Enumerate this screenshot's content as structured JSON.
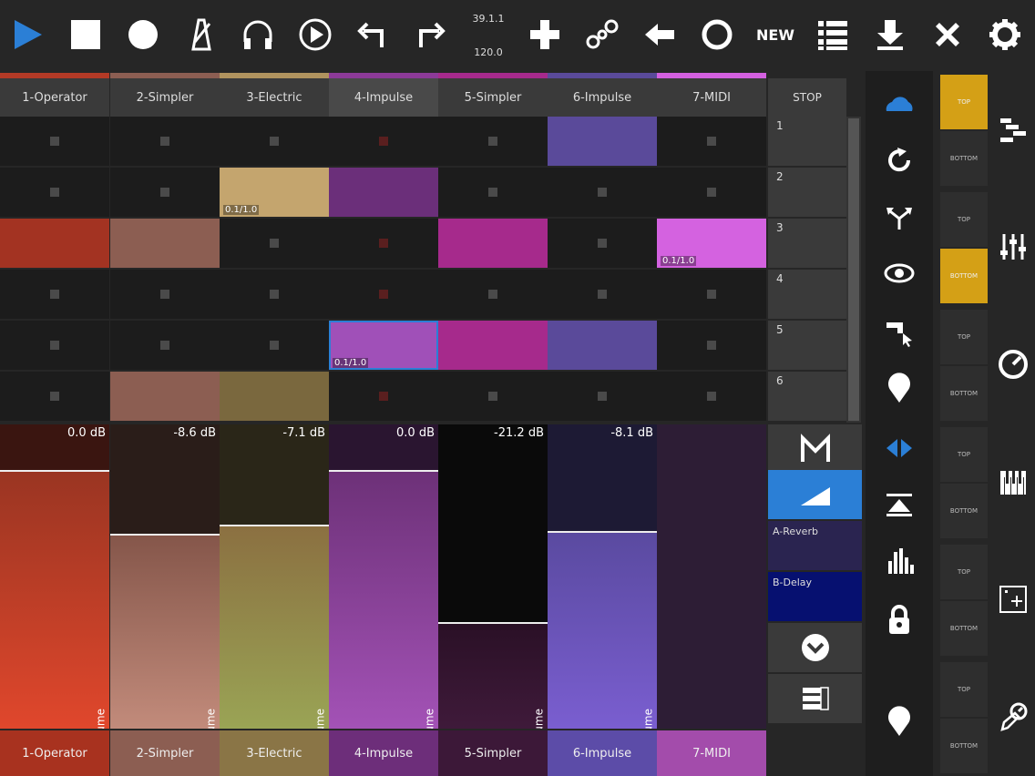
{
  "toolbar": {
    "icons": [
      "play-icon",
      "stop-icon",
      "record-icon",
      "metronome-icon",
      "headphones-icon",
      "play-circle-icon",
      "undo-icon",
      "redo-icon",
      "add-icon",
      "link-icon",
      "back-arrow-icon",
      "circle-icon",
      "list-icon",
      "download-icon",
      "close-icon",
      "gear-icon"
    ],
    "position": "39.1.1",
    "tempo": "120.0",
    "new_label": "NEW",
    "accent": "#2b7fd6"
  },
  "tracks": [
    {
      "name": "1-Operator",
      "color": "#b33a26",
      "volume_db": "0.0 dB",
      "volume_level": 0.85,
      "fader_top": "#3a1510",
      "fader_bottom": "#e0472c",
      "fill_top": "#9a3522",
      "footer": "#a8321f"
    },
    {
      "name": "2-Simpler",
      "color": "#8c5e52",
      "volume_db": "-8.6 dB",
      "volume_level": 0.64,
      "fader_top": "#2a1d19",
      "fader_bottom": "#c28b7b",
      "fill_top": "#85564a",
      "footer": "#8c5e52"
    },
    {
      "name": "3-Electric",
      "color": "#b0935e",
      "volume_db": "-7.1 dB",
      "volume_level": 0.67,
      "fader_top": "#2a2618",
      "fader_bottom": "#9aa455",
      "fill_top": "#8b7041",
      "footer": "#8a7546"
    },
    {
      "name": "4-Impulse",
      "color": "#8c3a98",
      "volume_db": "0.0 dB",
      "volume_level": 0.85,
      "fader_top": "#2a1530",
      "fader_bottom": "#a352b6",
      "fill_top": "#6d3178",
      "footer": "#6d2e7a"
    },
    {
      "name": "5-Simpler",
      "color": "#a62a8c",
      "volume_db": "-21.2 dB",
      "volume_level": 0.35,
      "fader_top": "#0a0a0a",
      "fader_bottom": "#3f1a3a",
      "fill_top": "#2a1026",
      "footer": "#3c1838"
    },
    {
      "name": "6-Impulse",
      "color": "#5a4a9a",
      "volume_db": "-8.1 dB",
      "volume_level": 0.65,
      "fader_top": "#1d1a34",
      "fader_bottom": "#7a5ed0",
      "fill_top": "#5a4aa0",
      "footer": "#5c4ca8"
    },
    {
      "name": "7-MIDI",
      "color": "#d460e0",
      "volume_db": "",
      "volume_level": 0,
      "fader_top": "#2d1d35",
      "fader_bottom": "#2d1d35",
      "fill_top": "#2d1d35",
      "footer": "#a34cab"
    }
  ],
  "clips": [
    [
      {
        "color": "",
        "label": ""
      },
      {
        "color": "",
        "label": ""
      },
      {
        "color": "",
        "label": ""
      },
      {
        "color": "",
        "label": "",
        "red": true
      },
      {
        "color": "",
        "label": ""
      },
      {
        "color": "#5a4a9a",
        "label": ""
      },
      {
        "color": "",
        "label": ""
      }
    ],
    [
      {
        "color": "",
        "label": ""
      },
      {
        "color": "",
        "label": ""
      },
      {
        "color": "#c4a56e",
        "label": "0.1/1.0"
      },
      {
        "color": "#6b2f7a",
        "label": ""
      },
      {
        "color": "",
        "label": ""
      },
      {
        "color": "",
        "label": ""
      },
      {
        "color": "",
        "label": ""
      }
    ],
    [
      {
        "color": "#a33322",
        "label": ""
      },
      {
        "color": "#8c5e52",
        "label": ""
      },
      {
        "color": "",
        "label": ""
      },
      {
        "color": "",
        "label": "",
        "red": true
      },
      {
        "color": "#a62a8c",
        "label": ""
      },
      {
        "color": "",
        "label": ""
      },
      {
        "color": "#d462e0",
        "label": "0.1/1.0"
      }
    ],
    [
      {
        "color": "",
        "label": ""
      },
      {
        "color": "",
        "label": ""
      },
      {
        "color": "",
        "label": ""
      },
      {
        "color": "",
        "label": "",
        "red": true
      },
      {
        "color": "",
        "label": ""
      },
      {
        "color": "",
        "label": ""
      },
      {
        "color": "",
        "label": ""
      }
    ],
    [
      {
        "color": "",
        "label": ""
      },
      {
        "color": "",
        "label": ""
      },
      {
        "color": "",
        "label": ""
      },
      {
        "color": "#a050b8",
        "label": "0.1/1.0",
        "sel": true
      },
      {
        "color": "#a62a8c",
        "label": ""
      },
      {
        "color": "#5a4a9a",
        "label": ""
      },
      {
        "color": "",
        "label": ""
      }
    ],
    [
      {
        "color": "",
        "label": ""
      },
      {
        "color": "#8c5e52",
        "label": ""
      },
      {
        "color": "#7a683e",
        "label": ""
      },
      {
        "color": "",
        "label": "",
        "red": true
      },
      {
        "color": "",
        "label": ""
      },
      {
        "color": "",
        "label": ""
      },
      {
        "color": "",
        "label": ""
      }
    ]
  ],
  "scenes": {
    "stop_label": "STOP",
    "labels": [
      "1",
      "2",
      "3",
      "4",
      "5",
      "6"
    ]
  },
  "mixer": {
    "volume_label": "Volume",
    "sends": [
      "A-Reverb",
      "B-Delay"
    ],
    "icons": [
      "master-icon",
      "volume-icon",
      "collapse-icon",
      "rsv-icon"
    ]
  },
  "side_icons": [
    "cloud-icon",
    "refresh-icon",
    "split-arrows-icon",
    "eye-icon",
    "cursor-select-icon",
    "location-pin-icon",
    "left-right-arrows-icon",
    "collapse-up-icon",
    "meter-icon",
    "lock-icon",
    "location-pin-icon"
  ],
  "right_panels": {
    "top_label": "TOP",
    "bottom_label": "BOTTOM",
    "items": [
      {
        "icon": "arrangement-icon",
        "top_on": true,
        "bot_on": false
      },
      {
        "icon": "mixer-sliders-icon",
        "top_on": false,
        "bot_on": true
      },
      {
        "icon": "dial-icon",
        "top_on": false,
        "bot_on": false
      },
      {
        "icon": "keyboard-icon",
        "top_on": false,
        "bot_on": false
      },
      {
        "icon": "add-device-icon",
        "top_on": false,
        "bot_on": false
      },
      {
        "icon": "edit-dial-icon",
        "top_on": false,
        "bot_on": false
      }
    ]
  }
}
